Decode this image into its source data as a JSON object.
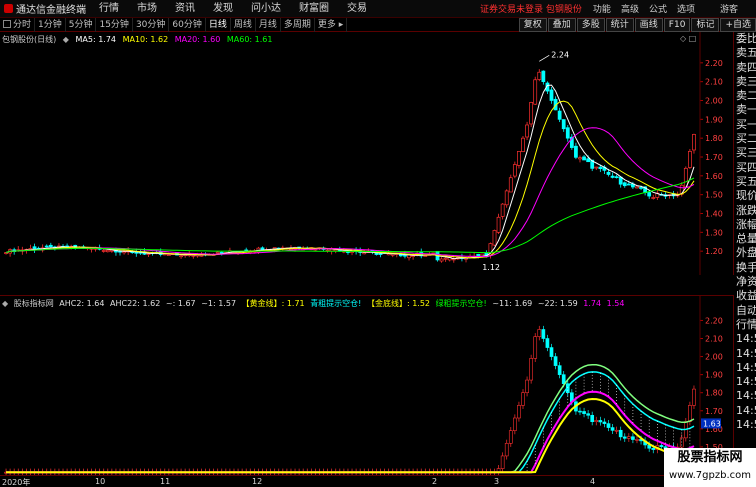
{
  "app": {
    "name": "通达信金融终端"
  },
  "menu": [
    "行情",
    "市场",
    "资讯",
    "发现",
    "问小达",
    "财富圈",
    "交易"
  ],
  "account": {
    "status": "证券交易未登录",
    "stock": "包钢股份"
  },
  "top_right": [
    "功能",
    "高级",
    "公式",
    "选项"
  ],
  "guest_label": "游客",
  "period_tabs": [
    "分时",
    "1分钟",
    "5分钟",
    "15分钟",
    "30分钟",
    "60分钟",
    "日线",
    "周线",
    "月线",
    "多周期",
    "更多"
  ],
  "active_period": "日线",
  "tools": [
    "复权",
    "叠加",
    "多股",
    "统计",
    "画线",
    "F10",
    "标记",
    "+自选"
  ],
  "main_title": "包钢股份(日线)",
  "ma": [
    {
      "label": "MA5: 1.74",
      "color": "#ffffff"
    },
    {
      "label": "MA10: 1.62",
      "color": "#ffff00"
    },
    {
      "label": "MA20: 1.60",
      "color": "#ff00ff"
    },
    {
      "label": "MA60: 1.61",
      "color": "#00ff00"
    }
  ],
  "price_axis": [
    "2.20",
    "2.10",
    "2.00",
    "1.90",
    "1.80",
    "1.70",
    "1.60",
    "1.50",
    "1.40",
    "1.30",
    "1.20"
  ],
  "annotations": {
    "high": "2.24",
    "low": "1.12"
  },
  "indicator_title": "股标指标网",
  "indicator_legend": [
    {
      "text": "AHC2: 1.64",
      "color": "#e0e0e0"
    },
    {
      "text": "AHC22: 1.62",
      "color": "#e0e0e0"
    },
    {
      "text": "~: 1.67",
      "color": "#e0e0e0"
    },
    {
      "text": "~1: 1.57",
      "color": "#e0e0e0"
    },
    {
      "text": "【黄金线】: 1.71",
      "color": "#ffff00"
    },
    {
      "text": "青粗提示空仓!",
      "color": "#00ffff"
    },
    {
      "text": "【金底线】: 1.52",
      "color": "#ffff00"
    },
    {
      "text": "绿粗提示空仓!",
      "color": "#00ff00"
    },
    {
      "text": "~11: 1.69",
      "color": "#e0e0e0"
    },
    {
      "text": "~22: 1.59",
      "color": "#e0e0e0"
    },
    {
      "text": "1.74",
      "color": "#ff00ff"
    },
    {
      "text": "1.54",
      "color": "#ff00ff"
    }
  ],
  "indicator_axis": [
    "2.20",
    "2.10",
    "2.00",
    "1.90",
    "1.80",
    "1.70",
    "1.60",
    "1.50",
    "1.40"
  ],
  "current_price_tag": "1.63",
  "right_panel": [
    "委比",
    "卖五",
    "卖四",
    "卖三",
    "卖二",
    "卖一",
    "买一",
    "买二",
    "买三",
    "买四",
    "买五",
    "现价",
    "涨跌",
    "涨幅",
    "总量",
    "外盘",
    "换手",
    "净资",
    "收益",
    "自动",
    "行情",
    "14:50",
    "14:50",
    "14:50",
    "14:50",
    "14:50",
    "14:50",
    "14:50"
  ],
  "time_axis": [
    {
      "label": "2020年",
      "pos": 2
    },
    {
      "label": "10",
      "pos": 95
    },
    {
      "label": "11",
      "pos": 160
    },
    {
      "label": "12",
      "pos": 252
    },
    {
      "label": "2",
      "pos": 432
    },
    {
      "label": "3",
      "pos": 494
    },
    {
      "label": "4",
      "pos": 590
    }
  ],
  "watermark": {
    "title": "股票指标网",
    "url": "www.7gpzb.com"
  }
}
